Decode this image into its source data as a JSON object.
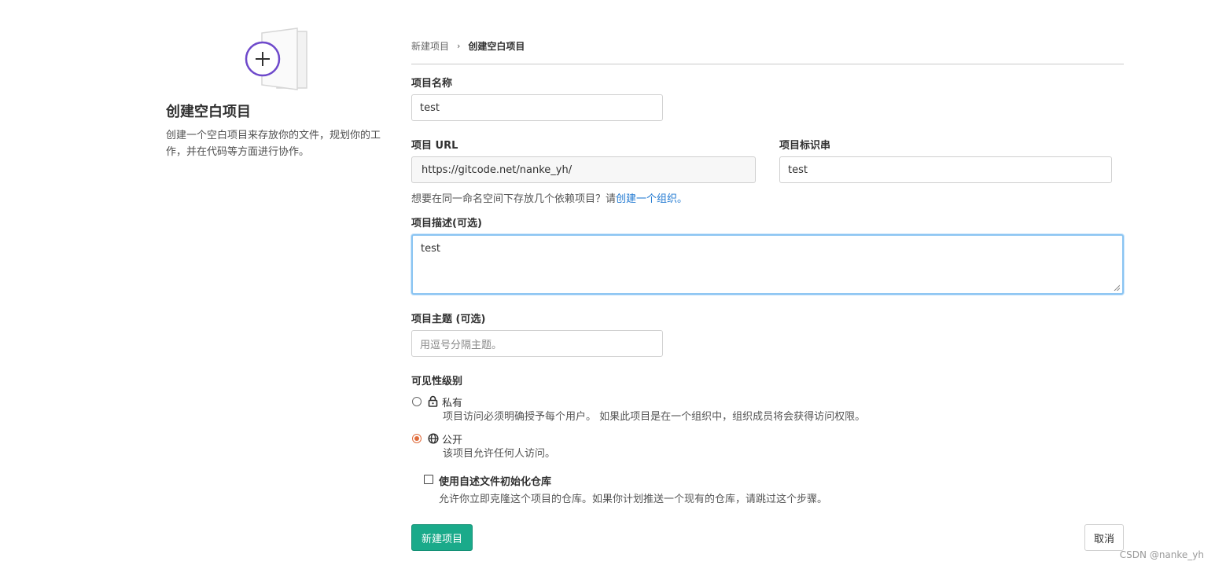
{
  "side": {
    "title": "创建空白项目",
    "description": "创建一个空白项目来存放你的文件，规划你的工作，并在代码等方面进行协作。"
  },
  "breadcrumb": {
    "parent": "新建项目",
    "separator": "›",
    "current": "创建空白项目"
  },
  "form": {
    "project_name": {
      "label": "项目名称",
      "value": "test"
    },
    "project_url": {
      "label": "项目 URL",
      "value": "https://gitcode.net/nanke_yh/"
    },
    "project_slug": {
      "label": "项目标识串",
      "value": "test"
    },
    "namespace_hint": {
      "text": "想要在同一命名空间下存放几个依赖项目？请",
      "link": "创建一个组织。"
    },
    "description": {
      "label": "项目描述(可选)",
      "value": "test"
    },
    "topics": {
      "label": "项目主题 (可选)",
      "placeholder": "用逗号分隔主题。"
    },
    "visibility": {
      "label": "可见性级别",
      "options": [
        {
          "title": "私有",
          "description": "项目访问必须明确授予每个用户。 如果此项目是在一个组织中，组织成员将会获得访问权限。",
          "icon": "lock-icon",
          "selected": false
        },
        {
          "title": "公开",
          "description": "该项目允许任何人访问。",
          "icon": "globe-icon",
          "selected": true
        }
      ]
    },
    "readme": {
      "title": "使用自述文件初始化仓库",
      "description": "允许你立即克隆这个项目的仓库。如果你计划推送一个现有的仓库，请跳过这个步骤。",
      "checked": false
    }
  },
  "actions": {
    "create": "新建项目",
    "cancel": "取消"
  },
  "watermark": "CSDN @nanke_yh",
  "colors": {
    "primary": "#1aaa8a",
    "link": "#1f78d1",
    "radio_selected": "#e06c3c",
    "focus": "#8ac4f2",
    "illustration": "#6e49cb"
  }
}
